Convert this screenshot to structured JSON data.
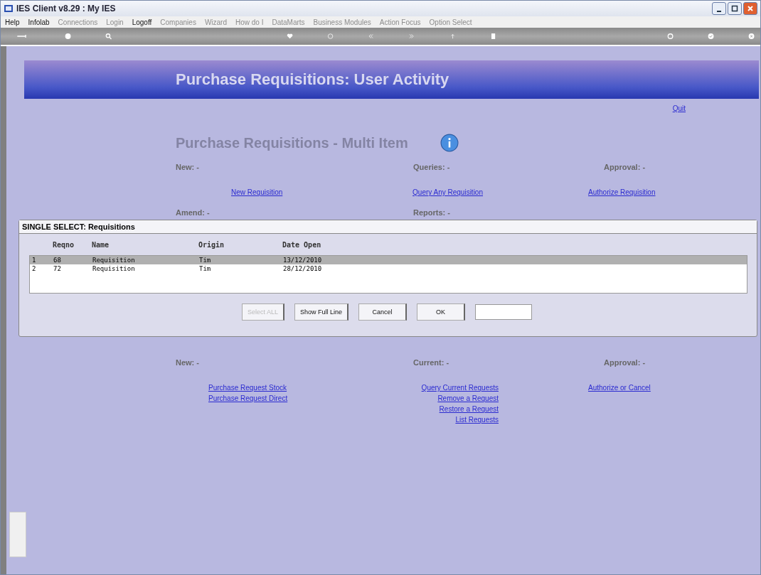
{
  "window": {
    "title": "IES Client v8.29 : My IES"
  },
  "menu": [
    {
      "label": "Help",
      "disabled": false
    },
    {
      "label": "Infolab",
      "disabled": false
    },
    {
      "label": "Connections",
      "disabled": true
    },
    {
      "label": "Login",
      "disabled": true
    },
    {
      "label": "Logoff",
      "disabled": false
    },
    {
      "label": "Companies",
      "disabled": true
    },
    {
      "label": "Wizard",
      "disabled": true
    },
    {
      "label": "How do I",
      "disabled": true
    },
    {
      "label": "DataMarts",
      "disabled": true
    },
    {
      "label": "Business Modules",
      "disabled": true
    },
    {
      "label": "Action Focus",
      "disabled": true
    },
    {
      "label": "Option Select",
      "disabled": true
    }
  ],
  "banner": {
    "title": "Purchase Requisitions: User Activity"
  },
  "quit_link": "Quit",
  "subtitle": "Purchase Requisitions - Multi Item",
  "top_sections": [
    {
      "label": "New: -",
      "links": [
        "New Requisition"
      ]
    },
    {
      "label": "Queries: -",
      "links": [
        "Query Any Requisition"
      ]
    },
    {
      "label": "Approval: -",
      "links": [
        "Authorize Requisition"
      ]
    }
  ],
  "mid_sections": [
    {
      "label": "Amend: -"
    },
    {
      "label": "Reports: -"
    }
  ],
  "dialog": {
    "title": "SINGLE SELECT: Requisitions",
    "columns": [
      "Reqno",
      "Name",
      "Origin",
      "Date Open"
    ],
    "rows": [
      {
        "index": "1",
        "cells": [
          "68",
          "Requisition",
          "Tim",
          "13/12/2010"
        ],
        "selected": true
      },
      {
        "index": "2",
        "cells": [
          "72",
          "Requisition",
          "Tim",
          "28/12/2010"
        ],
        "selected": false
      }
    ],
    "buttons": [
      {
        "label": "Select ALL",
        "disabled": true
      },
      {
        "label": "Show Full Line",
        "disabled": false
      },
      {
        "label": "Cancel",
        "disabled": false
      },
      {
        "label": "OK",
        "disabled": false
      }
    ]
  },
  "bottom_sections": [
    {
      "label": "New: -",
      "links": [
        "Purchase Request Stock",
        "Purchase Request Direct"
      ]
    },
    {
      "label": "Current: -",
      "links": [
        "Query Current Requests",
        "Remove a Request",
        "Restore a Request",
        "List Requests"
      ]
    },
    {
      "label": "Approval: -",
      "links": [
        "Authorize or Cancel"
      ]
    }
  ]
}
